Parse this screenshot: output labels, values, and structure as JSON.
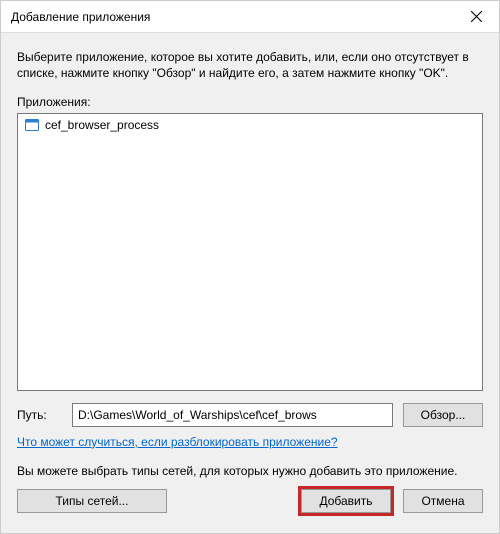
{
  "window": {
    "title": "Добавление приложения"
  },
  "intro": "Выберите приложение, которое вы хотите добавить, или, если оно отсутствует в списке, нажмите кнопку \"Обзор\" и найдите его, а затем нажмите кнопку \"OK\".",
  "apps_label": "Приложения:",
  "list": {
    "items": [
      {
        "label": "cef_browser_process"
      }
    ]
  },
  "path": {
    "label": "Путь:",
    "value": "D:\\Games\\World_of_Warships\\cef\\cef_brows"
  },
  "browse_label": "Обзор...",
  "help_link": "Что может случиться, если разблокировать приложение?",
  "types_text": "Вы можете выбрать типы сетей, для которых нужно добавить это приложение.",
  "buttons": {
    "network_types": "Типы сетей...",
    "add": "Добавить",
    "cancel": "Отмена"
  }
}
